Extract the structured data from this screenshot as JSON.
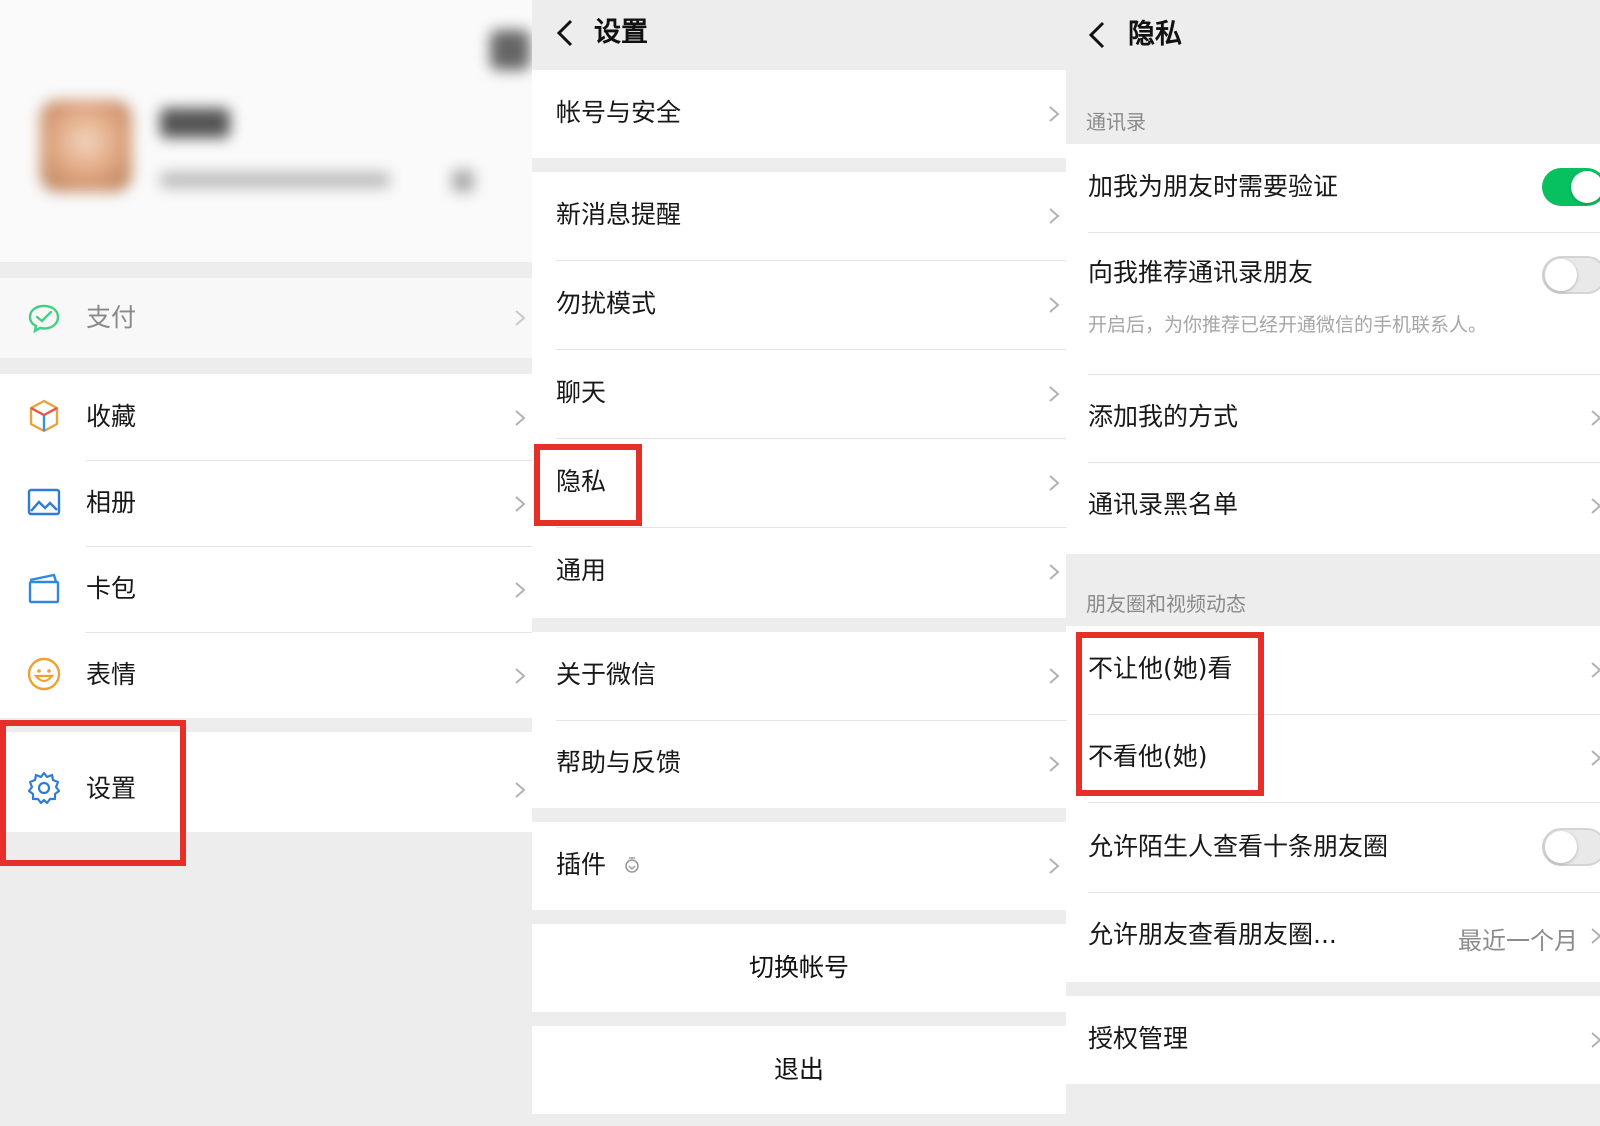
{
  "me_panel": {
    "menu": [
      {
        "label": "支付",
        "icon": "wechat-pay-icon"
      },
      {
        "label": "收藏",
        "icon": "favorites-cube-icon"
      },
      {
        "label": "相册",
        "icon": "album-picture-icon"
      },
      {
        "label": "卡包",
        "icon": "card-wallet-icon"
      },
      {
        "label": "表情",
        "icon": "sticker-smiley-icon"
      },
      {
        "label": "设置",
        "icon": "settings-gear-icon"
      }
    ]
  },
  "settings_panel": {
    "title": "设置",
    "items": [
      "帐号与安全",
      "新消息提醒",
      "勿扰模式",
      "聊天",
      "隐私",
      "通用",
      "关于微信",
      "帮助与反馈",
      "插件"
    ],
    "switch_account": "切换帐号",
    "logout": "退出"
  },
  "privacy_panel": {
    "title": "隐私",
    "contacts_section": "通讯录",
    "contacts_items": [
      {
        "label": "加我为朋友时需要验证",
        "toggle": true
      },
      {
        "label": "向我推荐通讯录朋友",
        "toggle": false,
        "sub": "开启后，为你推荐已经开通微信的手机联系人。"
      },
      {
        "label": "添加我的方式"
      },
      {
        "label": "通讯录黑名单"
      }
    ],
    "moments_section": "朋友圈和视频动态",
    "moments_items": [
      {
        "label": "不让他(她)看"
      },
      {
        "label": "不看他(她)"
      },
      {
        "label": "允许陌生人查看十条朋友圈",
        "toggle": false
      },
      {
        "label": "允许朋友查看朋友圈...",
        "value": "最近一个月"
      }
    ],
    "auth_management": "授权管理"
  },
  "colors": {
    "highlight": "#e5302a",
    "toggle_on": "#07c160",
    "background": "#ededed"
  }
}
